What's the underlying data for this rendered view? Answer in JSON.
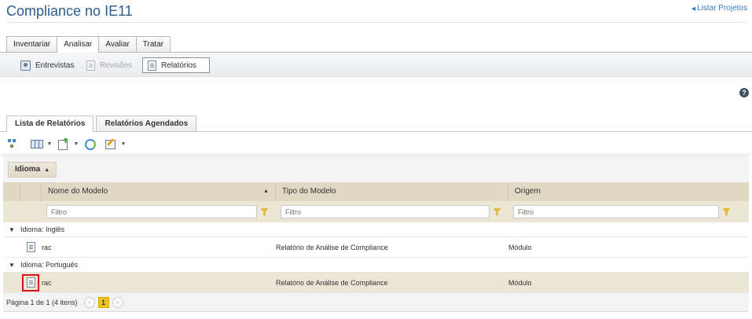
{
  "page": {
    "title": "Compliance no IE11",
    "back_link": "Listar Projetos"
  },
  "main_tabs": [
    {
      "label": "Inventariar"
    },
    {
      "label": "Analisar"
    },
    {
      "label": "Avaliar"
    },
    {
      "label": "Tratar"
    }
  ],
  "sub_tabs": [
    {
      "label": "Entrevistas"
    },
    {
      "label": "Revisões"
    },
    {
      "label": "Relatórios"
    }
  ],
  "help_icon": "?",
  "list_tabs": [
    {
      "label": "Lista de Relatórios"
    },
    {
      "label": "Relatórios Agendados"
    }
  ],
  "toolbar_icons": [
    "tree-icon",
    "group-columns-icon",
    "export-icon",
    "refresh-icon",
    "edit-icon"
  ],
  "grouping": {
    "chip_label": "Idioma"
  },
  "grid": {
    "columns": [
      "Nome do Modelo",
      "Tipo do Modelo",
      "Origem"
    ],
    "filter_placeholder": "Filtro",
    "groups": [
      {
        "label": "Idioma: Inglês",
        "rows": [
          {
            "name": "rac",
            "type": "Relatório de Análise de Compliance",
            "origin": "Módulo"
          }
        ]
      },
      {
        "label": "Idioma: Português",
        "rows": [
          {
            "name": "rac",
            "type": "Relatório de Análise de Compliance",
            "origin": "Módulo"
          }
        ]
      }
    ],
    "pager": {
      "summary": "Página 1 de 1 (4 itens)",
      "prev": "‹",
      "current": "1",
      "next": "›"
    }
  },
  "colors": {
    "title": "#2b5e8c",
    "header_bg": "#e0d8c4",
    "selection_bg": "#ece6d6",
    "highlight_box": "#e0101b",
    "pager_current": "#f2c41b"
  }
}
